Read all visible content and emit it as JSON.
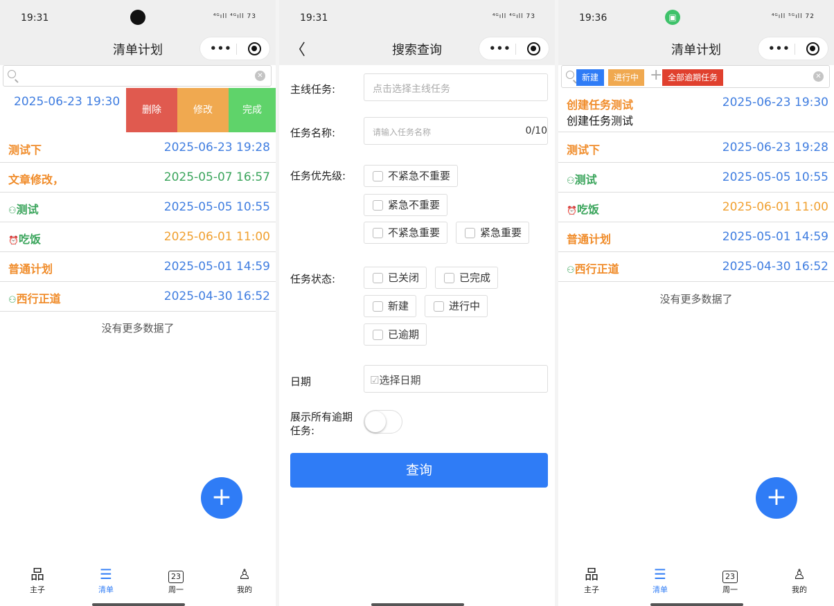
{
  "p1": {
    "time": "19:31",
    "signal": "⁴ᴳıll ⁴ᴳıll 73",
    "title": "清单计划",
    "swipe": {
      "date": "2025-06-23 19:30",
      "delete": "删除",
      "edit": "修改",
      "done": "完成"
    },
    "rows": [
      {
        "name": "测试下",
        "date": "2025-06-23 19:28"
      },
      {
        "name": "文章修改，",
        "date": "2025-05-07 16:57"
      },
      {
        "name": "测试",
        "date": "2025-05-05 10:55"
      },
      {
        "name": "吃饭",
        "date": "2025-06-01 11:00"
      },
      {
        "name": "普通计划",
        "date": "2025-05-01 14:59"
      },
      {
        "name": "西行正道",
        "date": "2025-04-30 16:52"
      }
    ],
    "nomore": "没有更多数据了"
  },
  "p2": {
    "time": "19:31",
    "signal": "⁴ᴳıll ⁴ᴳıll 73",
    "title": "搜索查询",
    "main_label": "主线任务:",
    "main_placeholder": "点击选择主线任务",
    "name_label": "任务名称:",
    "name_placeholder": "请输入任务名称",
    "name_count": "0/10",
    "priority_label": "任务优先级:",
    "priorities": [
      "不紧急不重要",
      "紧急不重要",
      "不紧急重要",
      "紧急重要"
    ],
    "status_label": "任务状态:",
    "statuses": [
      "已关闭",
      "已完成",
      "新建",
      "进行中",
      "已逾期"
    ],
    "date_label": "日期",
    "date_placeholder": "选择日期",
    "overdue_label": "展示所有逾期任务:",
    "query": "查询"
  },
  "p3": {
    "time": "19:36",
    "signal": "⁴ᴳıll ⁵ᴳıll 72",
    "title": "清单计划",
    "tags": {
      "new": "新建",
      "progress": "进行中",
      "overdue": "全部逾期任务"
    },
    "first": {
      "name": "创建任务测试",
      "sub": "创建任务测试",
      "date": "2025-06-23 19:30"
    },
    "rows": [
      {
        "name": "测试下",
        "date": "2025-06-23 19:28"
      },
      {
        "name": "测试",
        "date": "2025-05-05 10:55"
      },
      {
        "name": "吃饭",
        "date": "2025-06-01 11:00"
      },
      {
        "name": "普通计划",
        "date": "2025-05-01 14:59"
      },
      {
        "name": "西行正道",
        "date": "2025-04-30 16:52"
      }
    ],
    "nomore": "没有更多数据了"
  },
  "tabs": {
    "master": "主子",
    "list": "清单",
    "week": "周一",
    "week_day": "23",
    "mine": "我的"
  },
  "icons": [
    "more-icon",
    "target-icon",
    "search-icon",
    "clear-icon",
    "back-icon",
    "add-icon",
    "hierarchy-icon",
    "list-icon",
    "calendar-icon",
    "user-icon",
    "alarm-icon",
    "people-icon"
  ],
  "colors": {
    "accent": "#2f7cf6",
    "delete": "#e05a4f",
    "edit": "#f0a950",
    "done": "#5fd36a",
    "task": "#f08c2a",
    "date": "#3f7de0"
  }
}
